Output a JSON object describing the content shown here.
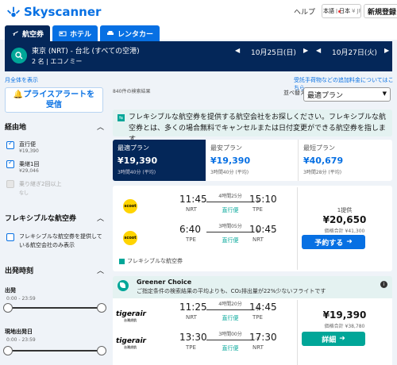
{
  "header": {
    "logo_text": "Skyscanner",
    "help_label": "ヘルプ",
    "locale_text": "日本語",
    "region_text": "日本",
    "currency_text": "¥ JPY",
    "signin_label": "新規登録"
  },
  "tabs": [
    {
      "label": "航空券",
      "icon": "plane-icon",
      "active": true
    },
    {
      "label": "ホテル",
      "icon": "bed-icon",
      "active": false
    },
    {
      "label": "レンタカー",
      "icon": "car-icon",
      "active": false
    }
  ],
  "search": {
    "route": "東京 (NRT) - 台北 (すべての空港)",
    "passengers": "2 名 | エコノミー",
    "depart_date": "10月25日(日)",
    "return_date": "10月27日(火)"
  },
  "links": {
    "price_table": "月全体を表示",
    "baggage": "受託手荷物などの追加料金についてはこちら"
  },
  "sidebar": {
    "alert_label_1": "プライスアラートを",
    "alert_label_2": "受信",
    "stops_title": "経由地",
    "stops": [
      {
        "label": "直行便",
        "price": "¥19,390",
        "checked": true,
        "disabled": false
      },
      {
        "label": "乗継1回",
        "price": "¥29,046",
        "checked": true,
        "disabled": false
      },
      {
        "label": "乗り継ぎ2回以上",
        "price": "なし",
        "checked": false,
        "disabled": true
      }
    ],
    "flexible_title": "フレキシブルな航空券",
    "flexible_option": "フレキシブルな航空券を提供している航空会社のみ表示",
    "times_title": "出発時刻",
    "depart_label": "出発",
    "depart_range": "0:00 - 23:59",
    "return_label": "現地出発日",
    "return_range": "0:00 - 23:59"
  },
  "results": {
    "count": "840件の検索結果",
    "sort_label": "並べ替え",
    "sort_value": "最適プラン",
    "flex_banner": "フレキシブルな航空券を提供する航空会社をお探しください。フレキシブルな航空券とは、多くの場合無料でキャンセルまたは日付変更ができる航空券を指します。",
    "sort_tabs": [
      {
        "label": "最適プラン",
        "price": "¥19,390",
        "sub": "3時間40分 (平均)",
        "active": true
      },
      {
        "label": "最安プラン",
        "price": "¥19,390",
        "sub": "3時間40分 (平均)",
        "active": false
      },
      {
        "label": "最短プラン",
        "price": "¥40,679",
        "sub": "3時間28分 (平均)",
        "active": false
      }
    ],
    "card1": {
      "airline": "scoot",
      "legs": [
        {
          "dep": "11:45",
          "dep_code": "NRT",
          "arr": "15:10",
          "arr_code": "TPE",
          "duration": "4時間25分",
          "type": "直行便"
        },
        {
          "dep": "6:40",
          "dep_code": "TPE",
          "arr": "10:45",
          "arr_code": "NRT",
          "duration": "3時間05分",
          "type": "直行便"
        }
      ],
      "provider": "1提供",
      "price": "¥20,650",
      "total": "価格合計 ¥41,300",
      "button": "予約する",
      "flex_note": "フレキシブルな航空券"
    },
    "greener": {
      "title": "Greener Choice",
      "subtitle": "ご指定条件の検索結果の平均よりも、CO₂排出量が22%少ないフライトです"
    },
    "card2": {
      "airline": "tigerair",
      "airline_sub": "台灣虎航",
      "legs": [
        {
          "dep": "11:25",
          "dep_code": "NRT",
          "arr": "14:45",
          "arr_code": "TPE",
          "duration": "4時間20分",
          "type": "直行便"
        },
        {
          "dep": "13:30",
          "dep_code": "TPE",
          "arr": "17:30",
          "arr_code": "NRT",
          "duration": "3時間00分",
          "type": "直行便"
        }
      ],
      "price": "¥19,390",
      "total": "価格合計 ¥38,780",
      "button": "詳細"
    }
  },
  "colors": {
    "brand": "#0770e3",
    "dark": "#042759",
    "teal": "#00a698"
  }
}
